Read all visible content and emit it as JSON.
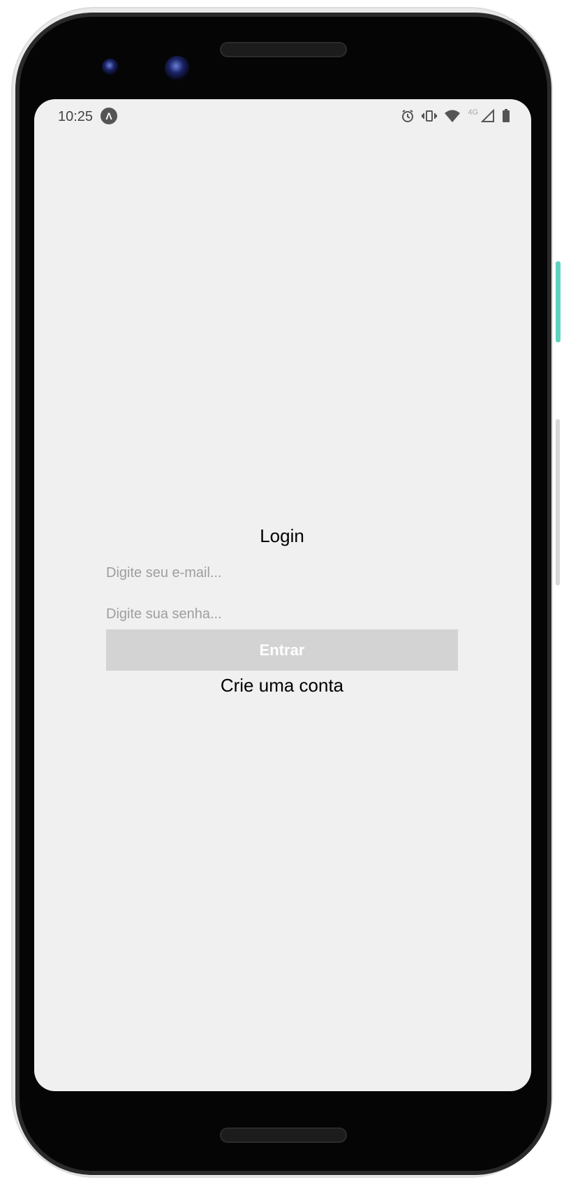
{
  "status_bar": {
    "time": "10:25",
    "app_icon_glyph": "Λ",
    "network_label": "4G",
    "icons": [
      "alarm-icon",
      "vibrate-icon",
      "wifi-icon",
      "signal-icon",
      "battery-icon"
    ]
  },
  "login": {
    "title": "Login",
    "email_placeholder": "Digite seu e-mail...",
    "password_placeholder": "Digite sua senha...",
    "submit_label": "Entrar",
    "create_account_label": "Crie uma conta"
  },
  "colors": {
    "screen_background": "#f0f0f0",
    "button_background": "#d3d3d3",
    "button_text": "#ffffff",
    "placeholder_text": "#9e9e9e",
    "side_button_accent": "#5fd3bf"
  }
}
